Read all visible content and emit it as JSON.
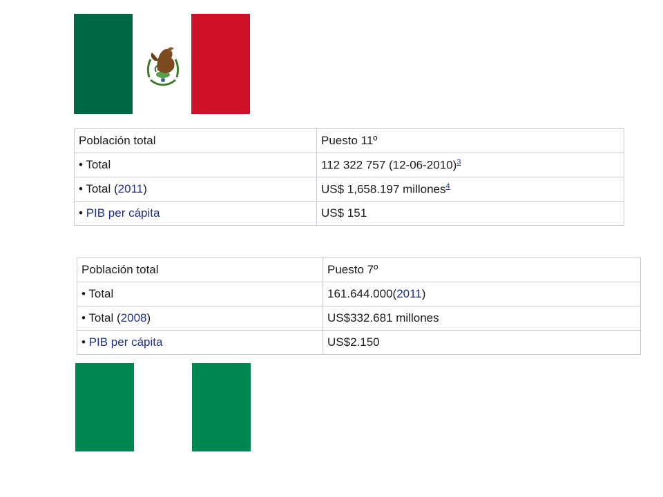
{
  "mexico": {
    "flag": {
      "colors": [
        "#006847",
        "#ffffff",
        "#ce1126"
      ],
      "emblem": "coat-of-arms-icon"
    },
    "rows": [
      {
        "label": "Población total",
        "value": "Puesto 11º"
      },
      {
        "bullet": "•",
        "label": "Total",
        "value": "112 322 757 (12-06-2010)",
        "ref": "3"
      },
      {
        "bullet": "•",
        "label_prefix": "Total (",
        "label_link": "2011",
        "label_suffix": ")",
        "value": "US$ 1,658.197 millones",
        "ref": "4"
      },
      {
        "bullet": "•",
        "label_link": "PIB per cápita",
        "value": "US$ 151"
      }
    ]
  },
  "nigeria": {
    "flag": {
      "colors": [
        "#008751",
        "#ffffff",
        "#008751"
      ]
    },
    "rows": [
      {
        "label": "Población total",
        "value": "Puesto 7º"
      },
      {
        "bullet": "•",
        "label": "Total",
        "value_prefix": "161.644.000(",
        "value_link": "2011",
        "value_suffix": ")"
      },
      {
        "bullet": "•",
        "label_prefix": "Total (",
        "label_link": "2008",
        "label_suffix": ")",
        "value": "US$332.681 millones"
      },
      {
        "bullet": "•",
        "label_link": "PIB per cápita",
        "value": "US$2.150"
      }
    ]
  }
}
